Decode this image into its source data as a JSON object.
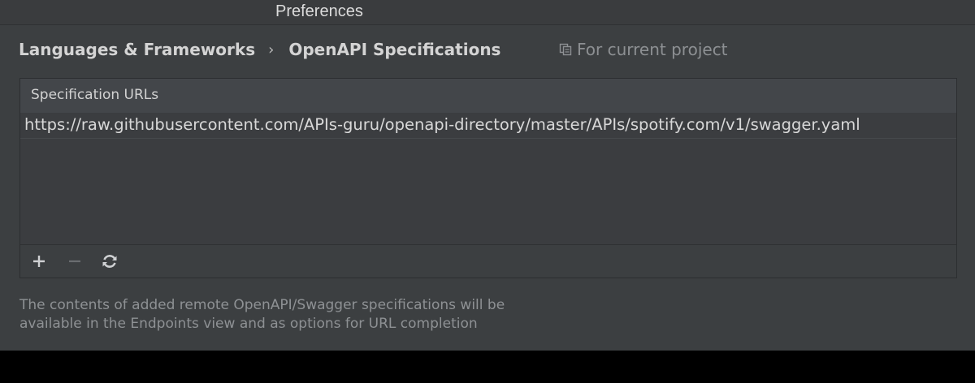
{
  "window": {
    "title": "Preferences"
  },
  "breadcrumb": {
    "items": [
      "Languages & Frameworks",
      "OpenAPI Specifications"
    ],
    "separator": "›"
  },
  "scope": {
    "label": "For current project",
    "icon": "copy-icon"
  },
  "spec_panel": {
    "header": "Specification URLs",
    "urls": [
      "https://raw.githubusercontent.com/APIs-guru/openapi-directory/master/APIs/spotify.com/v1/swagger.yaml"
    ]
  },
  "toolbar": {
    "add_icon": "plus-icon",
    "remove_icon": "minus-icon",
    "refresh_icon": "refresh-icon"
  },
  "help": {
    "line1": "The contents of added remote OpenAPI/Swagger specifications will be",
    "line2": "available in the Endpoints view and as options for URL completion"
  },
  "colors": {
    "background": "#3c3f41",
    "text": "#d4d4d4",
    "muted_text": "#8e9194"
  }
}
